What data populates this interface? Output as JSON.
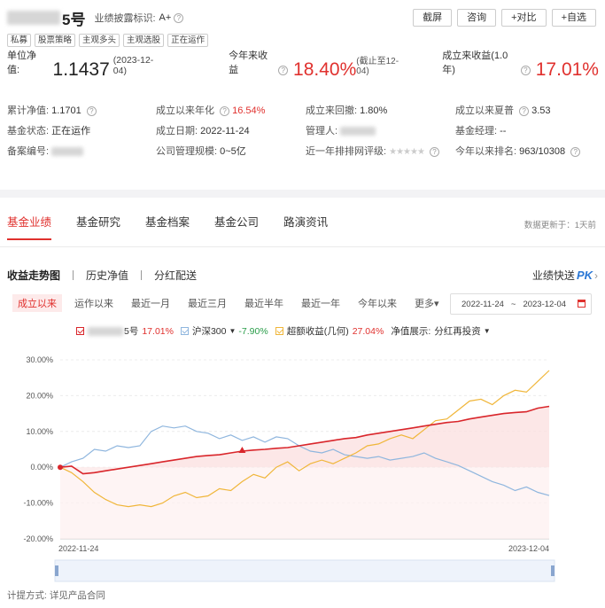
{
  "header": {
    "title_suffix": "5号",
    "disclosure_label": "业绩披露标识:",
    "disclosure_value": "A+",
    "buttons": [
      "截屏",
      "咨询",
      "+对比",
      "+自选"
    ],
    "tags": [
      "私募",
      "股票策略",
      "主观多头",
      "主观选股",
      "正在运作"
    ]
  },
  "nav": {
    "unit_label": "单位净值:",
    "unit_value": "1.1437",
    "unit_date": "(2023-12-04)",
    "ytd_label": "今年来收益",
    "ytd_value": "18.40%",
    "ytd_note": "(截止至12-04)",
    "since_label": "成立来收益(1.0年)",
    "since_value": "17.01%"
  },
  "info": {
    "cum_nav_label": "累计净值:",
    "cum_nav_value": "1.1701",
    "annual_label": "成立以来年化",
    "annual_value": "16.54%",
    "drawdown_label": "成立来回撤:",
    "drawdown_value": "1.80%",
    "sharpe_label": "成立以来夏普",
    "sharpe_value": "3.53",
    "status_label": "基金状态:",
    "status_value": "正在运作",
    "inception_label": "成立日期:",
    "inception_value": "2022-11-24",
    "manager_label": "管理人:",
    "fund_manager_label": "基金经理:",
    "fund_manager_value": "--",
    "record_label": "备案编号:",
    "scale_label": "公司管理规模:",
    "scale_value": "0~5亿",
    "rating_label": "近一年排排网评级:",
    "rank_label": "今年以来排名:",
    "rank_value": "963/10308"
  },
  "tabs": [
    "基金业绩",
    "基金研究",
    "基金档案",
    "基金公司",
    "路演资讯"
  ],
  "update_text": "数据更新于：1天前",
  "sub_tabs": [
    "收益走势图",
    "历史净值",
    "分红配送"
  ],
  "pk_text": "业绩快送",
  "pk_badge": "PK",
  "ranges": [
    "成立以来",
    "运作以来",
    "最近一月",
    "最近三月",
    "最近半年",
    "最近一年",
    "今年以来",
    "更多▾"
  ],
  "date_start": "2022-11-24",
  "date_tilde": "~",
  "date_end": "2023-12-04",
  "legend": {
    "fund_suffix": "5号",
    "fund_value": "17.01%",
    "index_name": "沪深300",
    "index_value": "-7.90%",
    "excess_name": "超额收益(几何)",
    "excess_value": "27.04%",
    "display_label": "净值展示:",
    "display_value": "分红再投资"
  },
  "colors": {
    "fund": "#d9262b",
    "index": "#8fb6de",
    "excess": "#f0b63a",
    "accent": "#e0312e"
  },
  "chart_data": {
    "type": "line",
    "ylim": [
      -20,
      30
    ],
    "yticks": [
      "30.00%",
      "20.00%",
      "10.00%",
      "0.00%",
      "-10.00%",
      "-20.00%"
    ],
    "xticks": [
      "2022-11-24",
      "2023-12-04"
    ],
    "series": [
      {
        "name": "5号",
        "values": [
          0,
          0.3,
          -1.8,
          -1.5,
          -1.0,
          -0.5,
          0,
          0.5,
          1.0,
          1.5,
          2.0,
          2.5,
          3.0,
          3.3,
          3.5,
          4.0,
          4.5,
          4.8,
          5.0,
          5.3,
          5.5,
          6.0,
          6.5,
          7.0,
          7.5,
          8.0,
          8.3,
          9.0,
          9.5,
          10.0,
          10.5,
          11.0,
          11.5,
          12.0,
          12.5,
          12.8,
          13.5,
          14.0,
          14.5,
          15.0,
          15.3,
          15.5,
          16.5,
          17.01
        ]
      },
      {
        "name": "沪深300",
        "values": [
          0,
          1.5,
          2.5,
          5.0,
          4.5,
          6.0,
          5.5,
          6.0,
          10.0,
          11.5,
          11.0,
          11.5,
          10.0,
          9.5,
          8.0,
          9.0,
          7.5,
          8.5,
          7.0,
          8.5,
          8.0,
          6.0,
          4.5,
          4.0,
          5.0,
          3.5,
          3.0,
          2.5,
          3.0,
          2.0,
          2.5,
          3.0,
          4.0,
          2.5,
          1.5,
          0.5,
          -1.0,
          -2.5,
          -4.0,
          -5.0,
          -6.5,
          -5.5,
          -7.0,
          -7.9
        ]
      },
      {
        "name": "超额收益(几何)",
        "values": [
          0,
          -1.5,
          -4.0,
          -7.0,
          -9.0,
          -10.5,
          -11.0,
          -10.5,
          -11.0,
          -10.0,
          -8.0,
          -7.0,
          -8.5,
          -8.0,
          -6.0,
          -6.5,
          -4.0,
          -2.0,
          -3.0,
          0,
          1.5,
          -1.0,
          1.0,
          2.0,
          1.0,
          2.5,
          4.0,
          6.0,
          6.5,
          8.0,
          9.0,
          8.0,
          10.5,
          13.0,
          13.5,
          16.0,
          18.5,
          19.0,
          17.5,
          20.0,
          21.5,
          21.0,
          24.0,
          27.04
        ]
      }
    ]
  },
  "footer_label": "计提方式:",
  "footer_value": "详见产品合同"
}
